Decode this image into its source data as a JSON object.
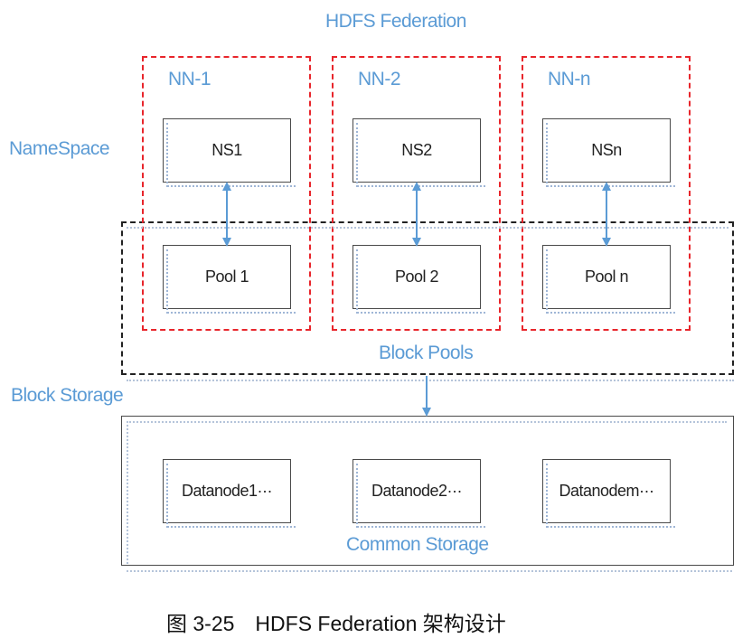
{
  "diagram": {
    "title": "HDFS Federation",
    "namespace_label": "NameSpace",
    "block_storage_label": "Block Storage",
    "block_pools_label": "Block Pools",
    "common_storage_label": "Common Storage",
    "namenodes": [
      {
        "label": "NN-1",
        "ns": "NS1",
        "pool": "Pool 1"
      },
      {
        "label": "NN-2",
        "ns": "NS2",
        "pool": "Pool 2"
      },
      {
        "label": "NN-n",
        "ns": "NSn",
        "pool": "Pool n"
      }
    ],
    "datanodes": [
      "Datanode1···",
      "Datanode2···",
      "Datanodem···"
    ]
  },
  "caption": "图 3-25　HDFS Federation 架构设计",
  "colors": {
    "label_blue": "#5b9bd5",
    "namenode_border": "#e8252b",
    "block_pool_border": "#222222",
    "arrow": "#5b9bd5"
  }
}
